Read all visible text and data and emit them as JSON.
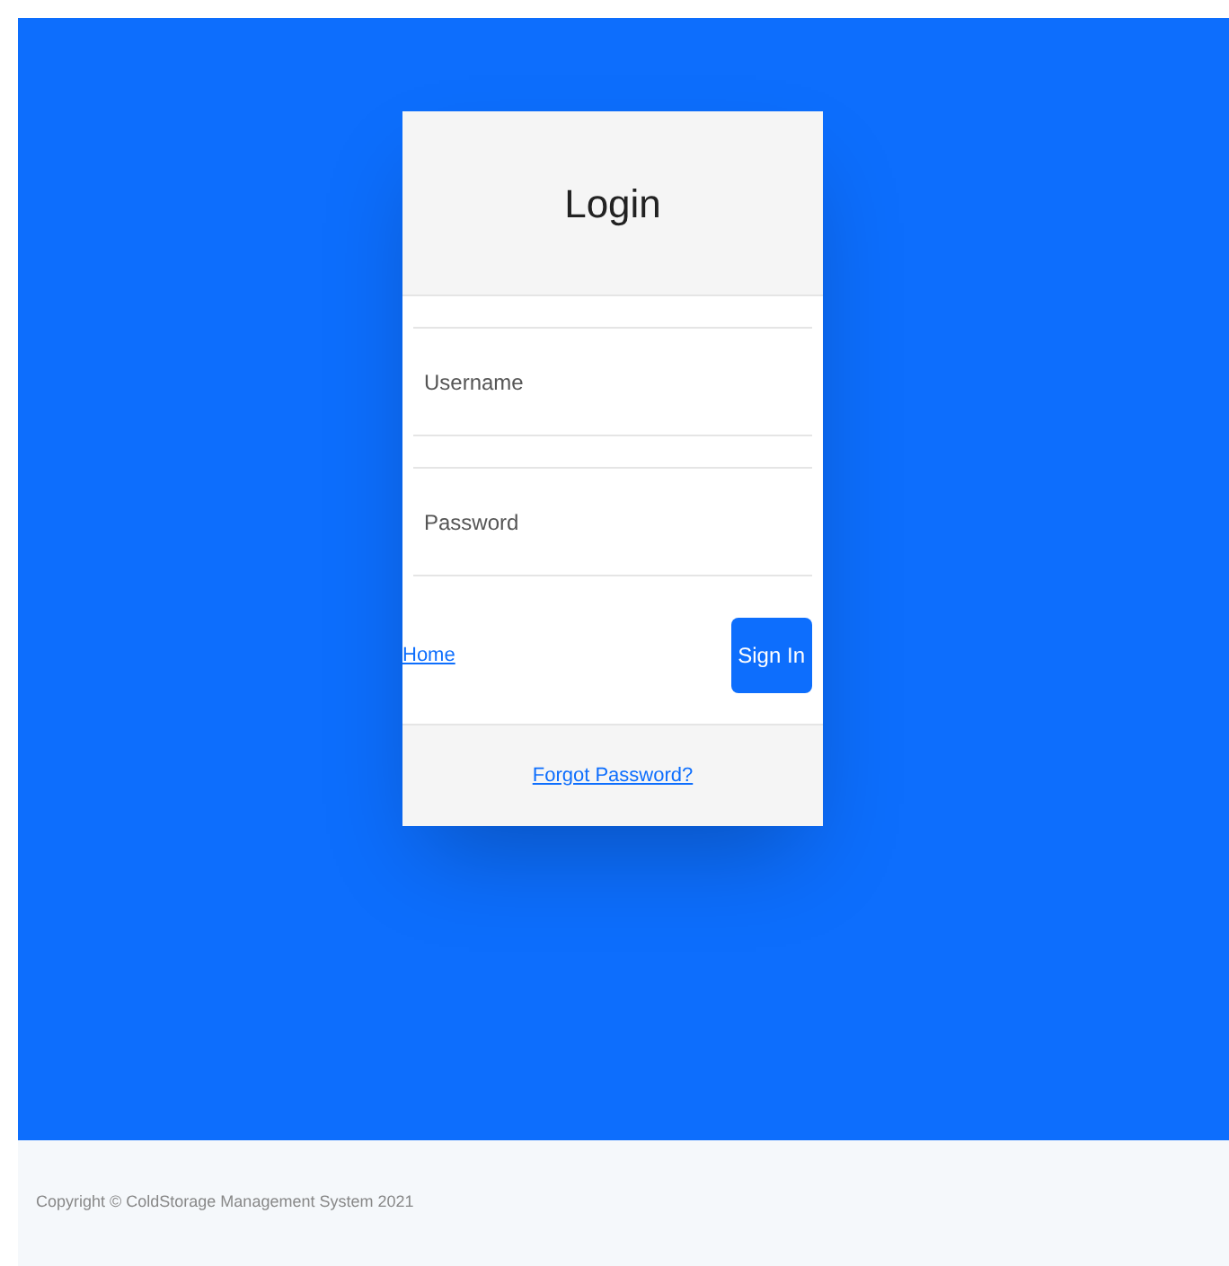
{
  "login_card": {
    "title": "Login",
    "fields": [
      {
        "placeholder": "Username"
      },
      {
        "placeholder": "Password"
      }
    ],
    "home_link": "Home",
    "sign_in_button": "Sign In",
    "forgot_password_link": "Forgot Password?"
  },
  "footer": {
    "copyright": "Copyright © ColdStorage Management System 2021"
  }
}
